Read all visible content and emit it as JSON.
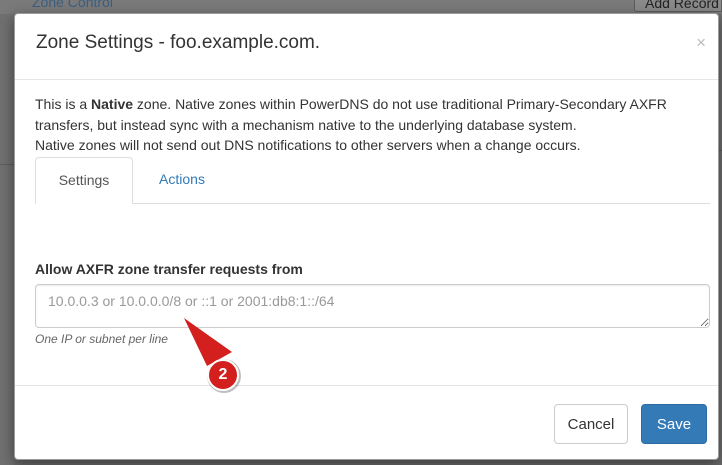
{
  "background": {
    "link_text": "Zone Control",
    "button_text": "Add Record"
  },
  "modal": {
    "title": "Zone Settings - foo.example.com.",
    "close_glyph": "×",
    "intro": {
      "part1": "This is a ",
      "bold": "Native",
      "part2": " zone. Native zones within PowerDNS do not use traditional Primary-Secondary AXFR transfers, but instead sync with a mechanism native to the underlying database system.",
      "line2": "Native zones will not send out DNS notifications to other servers when a change occurs."
    },
    "tabs": [
      {
        "label": "Settings",
        "active": true
      },
      {
        "label": "Actions",
        "active": false
      }
    ],
    "field_label": "Allow AXFR zone transfer requests from",
    "textarea_value": "",
    "textarea_placeholder": "10.0.0.3 or 10.0.0.0/8 or ::1 or 2001:db8:1::/64",
    "help_text": "One IP or subnet per line",
    "footer": {
      "cancel_label": "Cancel",
      "save_label": "Save"
    }
  },
  "annotation": {
    "number": "2",
    "color": "#d41f1f"
  },
  "colors": {
    "primary": "#337ab7",
    "link": "#337ab7",
    "backdrop": "#6f6f6f"
  }
}
